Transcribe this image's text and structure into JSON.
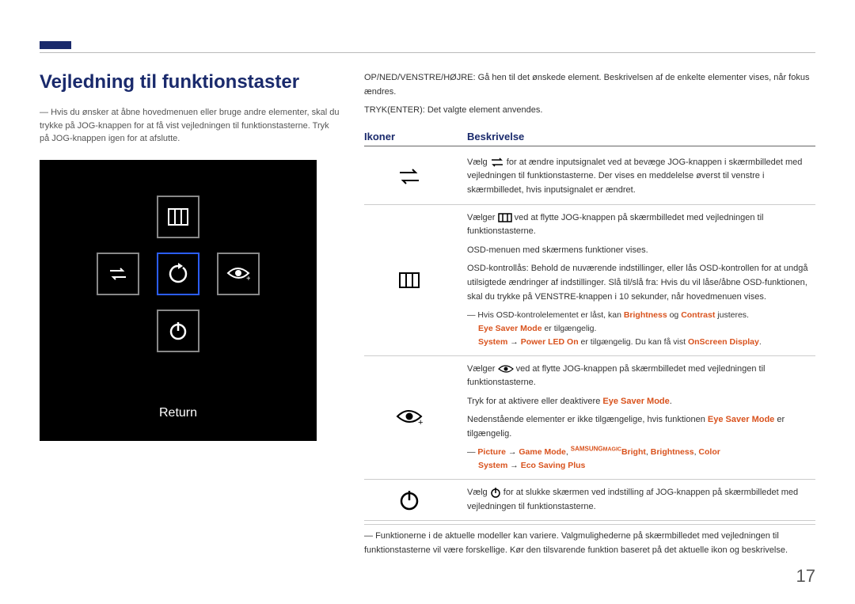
{
  "page_number": "17",
  "title": "Vejledning til funktionstaster",
  "left_note": "Hvis du ønsker at åbne hovedmenuen eller bruge andre elementer, skal du trykke på JOG-knappen for at få vist vejledningen til funktionstasterne. Tryk på JOG-knappen igen for at afslutte.",
  "osd_return": "Return",
  "right_intro_line1": "OP/NED/VENSTRE/HØJRE: Gå hen til det ønskede element. Beskrivelsen af de enkelte elementer vises, når fokus ændres.",
  "right_intro_line2": "TRYK(ENTER): Det valgte element anvendes.",
  "tbl": {
    "h_icon": "Ikoner",
    "h_desc": "Beskrivelse",
    "row1": {
      "p1a": "Vælg ",
      "p1b": " for at ændre inputsignalet ved at bevæge JOG-knappen i skærmbilledet med vejledningen til funktionstasterne. Der vises en meddelelse øverst til venstre i skærmbilledet, hvis inputsignalet er ændret."
    },
    "row2": {
      "p1a": "Vælger ",
      "p1b": " ved at flytte JOG-knappen på skærmbilledet med vejledningen til funktionstasterne.",
      "p2": "OSD-menuen med skærmens funktioner vises.",
      "p3": "OSD-kontrollås: Behold de nuværende indstillinger, eller lås OSD-kontrollen for at undgå utilsigtede ændringer af indstillinger. Slå til/slå fra: Hvis du vil låse/åbne OSD-funktionen, skal du trykke på VENSTRE-knappen i 10 sekunder, når hovedmenuen vises.",
      "n1a": "Hvis OSD-kontrolelementet er låst, kan ",
      "n1_brightness": "Brightness",
      "n1_og": " og ",
      "n1_contrast": "Contrast",
      "n1b": " justeres.",
      "n2_esm": "Eye Saver Mode",
      "n2b": " er tilgængelig.",
      "n3_system": "System",
      "n3_arrow": " → ",
      "n3_pled": "Power LED On",
      "n3_mid": " er tilgængelig. Du kan få vist ",
      "n3_osd": "OnScreen Display",
      "n3_end": "."
    },
    "row3": {
      "p1a": "Vælger ",
      "p1b": " ved at flytte JOG-knappen på skærmbilledet med vejledningen til funktionstasterne.",
      "p2a": "Tryk for at aktivere eller deaktivere ",
      "p2_esm": "Eye Saver Mode",
      "p2b": ".",
      "p3a": "Nedenstående elementer er ikke tilgængelige, hvis funktionen ",
      "p3_esm": "Eye Saver Mode",
      "p3b": " er tilgængelig.",
      "n1_picture": "Picture",
      "n1_arrow1": " → ",
      "n1_game": "Game Mode",
      "n1_comma1": ", ",
      "n1_magic_pre": "SAMSUNG",
      "n1_magic": "MAGIC",
      "n1_bright": "Bright",
      "n1_comma2": ", ",
      "n1_brightness": "Brightness",
      "n1_comma3": ", ",
      "n1_color": "Color",
      "n2_system": "System",
      "n2_arrow": " → ",
      "n2_eco": "Eco Saving Plus"
    },
    "row4": {
      "p1a": "Vælg ",
      "p1b": " for at slukke skærmen ved indstilling af JOG-knappen på skærmbilledet med vejledningen til funktionstasterne."
    }
  },
  "bottom_note": "Funktionerne i de aktuelle modeller kan variere. Valgmulighederne på skærmbilledet med vejledningen til funktionstasterne vil være forskellige. Kør den tilsvarende funktion baseret på det aktuelle ikon og beskrivelse."
}
